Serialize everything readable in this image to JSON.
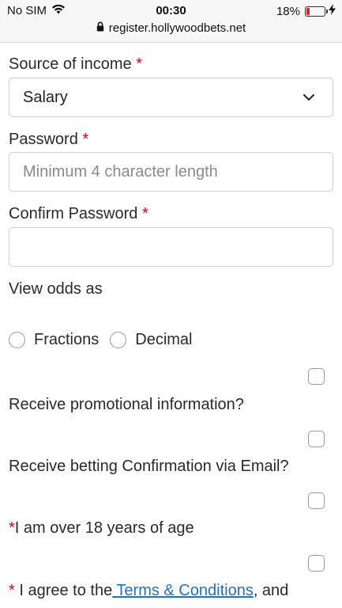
{
  "status_bar": {
    "carrier": "No SIM",
    "time": "00:30",
    "battery": "18%",
    "battery_level": 0.18,
    "url": "register.hollywoodbets.net"
  },
  "form": {
    "source_of_income": {
      "label": "Source of income",
      "required_mark": "*",
      "value": "Salary"
    },
    "password": {
      "label": "Password",
      "required_mark": "*",
      "placeholder": "Minimum 4 character length"
    },
    "confirm_password": {
      "label": "Confirm Password",
      "required_mark": "*",
      "placeholder": ""
    },
    "odds": {
      "label": "View odds as",
      "options": [
        "Fractions",
        "Decimal"
      ]
    },
    "promotional": {
      "label": "Receive promotional information?"
    },
    "betting_email": {
      "label": "Receive betting Confirmation via Email?"
    },
    "age": {
      "required_mark": "*",
      "label": "I am over 18 years of age"
    },
    "terms": {
      "required_mark": "*",
      "prefix": " I agree to the",
      "link": " Terms & Conditions",
      "suffix": ", and"
    }
  },
  "colors": {
    "required": "#d0021b",
    "link": "#1b73c8",
    "battery_low": "#e0261b"
  }
}
